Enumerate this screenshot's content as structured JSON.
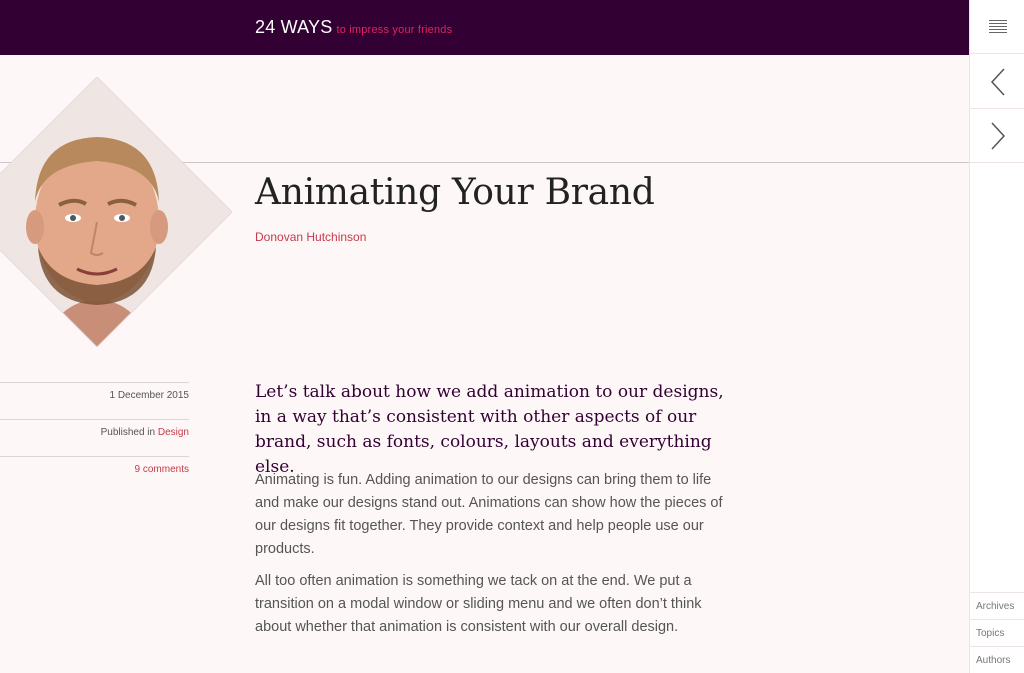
{
  "header": {
    "logo": "24 WAYS",
    "tagline": "to impress your friends",
    "bg_color": "#330033",
    "tagline_color": "#e0245e"
  },
  "rail": {
    "menu_icon": "menu-icon",
    "prev_icon": "chevron-left-icon",
    "next_icon": "chevron-right-icon",
    "links": [
      "Archives",
      "Topics",
      "Authors"
    ]
  },
  "article": {
    "title": "Animating Your Brand",
    "author": "Donovan Hutchinson",
    "date": "1 December 2015",
    "published_prefix": "Published in",
    "category": "Design",
    "comments": "9 comments",
    "intro": "Let’s talk about how we add animation to our designs, in a way that’s consistent with other aspects of our brand, such as fonts, colours, layouts and everything else.",
    "paragraphs": [
      "Animating is fun. Adding animation to our designs can bring them to life and make our designs stand out. Animations can show how the pieces of our designs fit together. They provide context and help people use our products.",
      "All too often animation is something we tack on at the end. We put a transition on a modal window or sliding menu and we often don’t think about whether that animation is consistent with our overall design."
    ]
  },
  "colors": {
    "accent": "#c63b4a",
    "page_bg": "#fdf7f7",
    "heading": "#222222",
    "intro_text": "#330033"
  }
}
